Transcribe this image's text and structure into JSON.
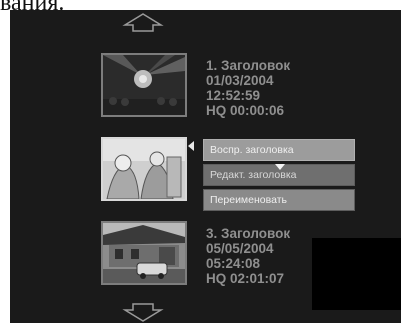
{
  "page": {
    "header_text": "вания."
  },
  "titles": [
    {
      "name": "1. Заголовок",
      "date": "01/03/2004",
      "time": "12:52:59",
      "duration": "HQ 00:00:06"
    },
    {
      "name": "",
      "date": "",
      "time": "",
      "duration": ""
    },
    {
      "name": "3. Заголовок",
      "date": "05/05/2004",
      "time": "05:24:08",
      "duration": "HQ 02:01:07"
    }
  ],
  "context_menu": {
    "items": [
      {
        "label": "Воспр. заголовка"
      },
      {
        "label": "Редакт. заголовка"
      },
      {
        "label": "Переименовать"
      }
    ]
  },
  "icons": {
    "scroll_up": "arrow-up-icon",
    "scroll_down": "arrow-down-icon"
  },
  "colors": {
    "background": "#1a1a1a",
    "text": "#8f8f8f",
    "menu": "#8a8a8a"
  }
}
